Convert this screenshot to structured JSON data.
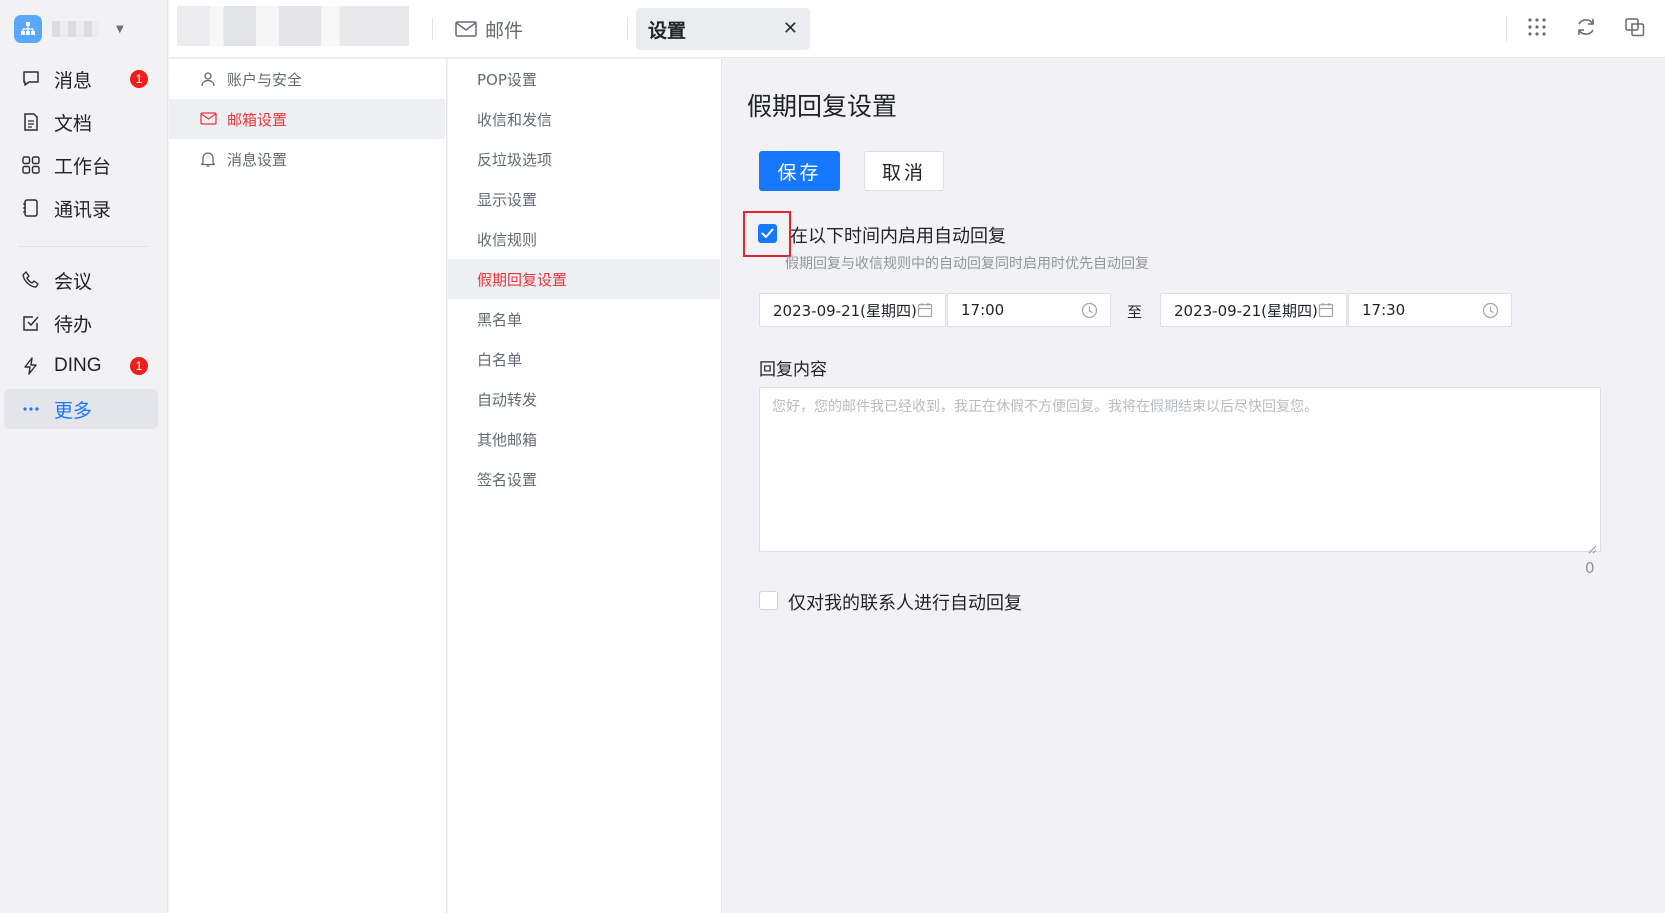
{
  "rail": {
    "items": [
      {
        "label": "消息",
        "icon": "chat-bubble-icon",
        "badge": "1"
      },
      {
        "label": "文档",
        "icon": "document-icon"
      },
      {
        "label": "工作台",
        "icon": "grid-icon"
      },
      {
        "label": "通讯录",
        "icon": "contacts-icon"
      },
      {
        "label": "会议",
        "icon": "phone-icon"
      },
      {
        "label": "待办",
        "icon": "todo-check-icon"
      },
      {
        "label": "DING",
        "icon": "lightning-icon",
        "badge": "1"
      },
      {
        "label": "更多",
        "icon": "more-dots-icon",
        "active": true
      }
    ]
  },
  "topbar": {
    "tabs": [
      {
        "label": "邮件",
        "icon": "mail-icon"
      },
      {
        "label": "设置",
        "active": true,
        "close": "✕"
      }
    ],
    "actions": [
      "apps-grid-icon",
      "refresh-icon",
      "window-switch-icon"
    ]
  },
  "categories": [
    {
      "label": "账户与安全",
      "icon": "user-icon"
    },
    {
      "label": "邮箱设置",
      "icon": "mail-settings-icon",
      "active": true
    },
    {
      "label": "消息设置",
      "icon": "bell-icon"
    }
  ],
  "subcategories": [
    {
      "label": "POP设置"
    },
    {
      "label": "收信和发信"
    },
    {
      "label": "反垃圾选项"
    },
    {
      "label": "显示设置"
    },
    {
      "label": "收信规则"
    },
    {
      "label": "假期回复设置",
      "active": true
    },
    {
      "label": "黑名单"
    },
    {
      "label": "白名单"
    },
    {
      "label": "自动转发"
    },
    {
      "label": "其他邮箱"
    },
    {
      "label": "签名设置"
    }
  ],
  "content": {
    "title": "假期回复设置",
    "save_label": "保存",
    "cancel_label": "取消",
    "enable_label": "在以下时间内启用自动回复",
    "enable_checked": true,
    "hint": "假期回复与收信规则中的自动回复同时启用时优先自动回复",
    "start_date": "2023-09-21(星期四)",
    "start_time": "17:00",
    "to_label": "至",
    "end_date": "2023-09-21(星期四)",
    "end_time": "17:30",
    "reply_label": "回复内容",
    "reply_placeholder": "您好，您的邮件我已经收到，我正在休假不方便回复。我将在假期结束以后尽快回复您。",
    "reply_value": "",
    "char_count": "0",
    "contacts_only_label": "仅对我的联系人进行自动回复",
    "contacts_only_checked": false
  },
  "colors": {
    "accent": "#1677ff",
    "active_red": "#e8373c",
    "badge": "#f01d1d",
    "highlight_box": "#e4242b"
  }
}
